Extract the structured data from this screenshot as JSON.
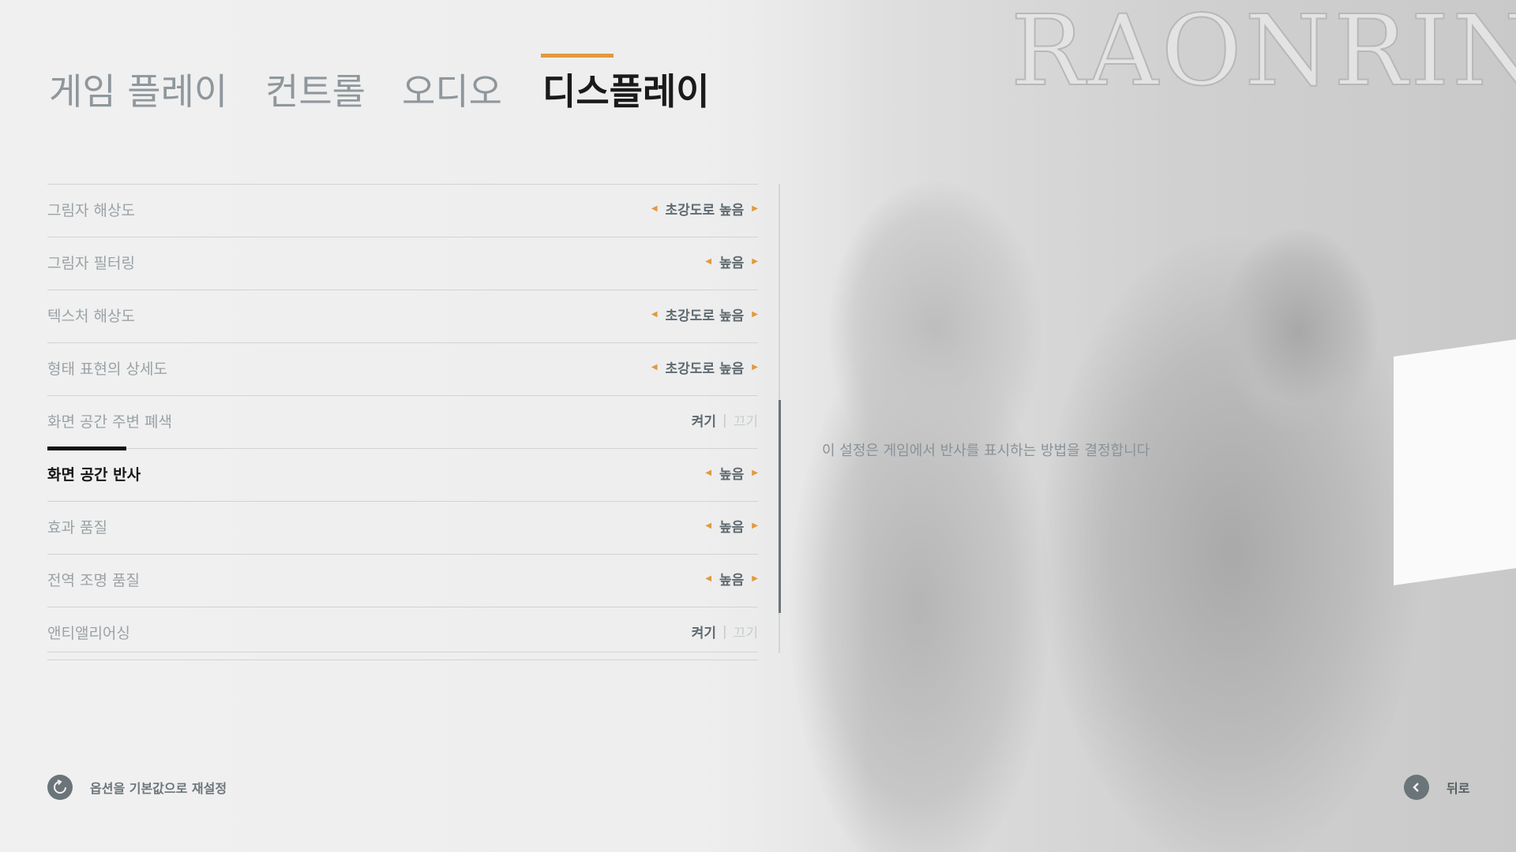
{
  "logo": {
    "text": "RAONRIN"
  },
  "tabs": [
    {
      "label": "게임 플레이",
      "active": false
    },
    {
      "label": "컨트롤",
      "active": false
    },
    {
      "label": "오디오",
      "active": false
    },
    {
      "label": "디스플레이",
      "active": true
    }
  ],
  "settings": [
    {
      "label": "그림자 해상도",
      "type": "selector",
      "value": "초강도로 높음"
    },
    {
      "label": "그림자 필터링",
      "type": "selector",
      "value": "높음"
    },
    {
      "label": "텍스처 해상도",
      "type": "selector",
      "value": "초강도로 높음"
    },
    {
      "label": "형태 표현의 상세도",
      "type": "selector",
      "value": "초강도로 높음"
    },
    {
      "label": "화면 공간 주변 폐색",
      "type": "toggle",
      "on_label": "켜기",
      "off_label": "끄기"
    },
    {
      "label": "화면 공간 반사",
      "type": "selector",
      "value": "높음",
      "selected": true
    },
    {
      "label": "효과 품질",
      "type": "selector",
      "value": "높음"
    },
    {
      "label": "전역 조명 품질",
      "type": "selector",
      "value": "높음"
    },
    {
      "label": "앤티앨리어싱",
      "type": "toggle",
      "on_label": "켜기",
      "off_label": "끄기"
    }
  ],
  "description": "이 설정은 게임에서 반사를 표시하는 방법을 결정합니다",
  "footer": {
    "reset_label": "옵션을 기본값으로 재설정",
    "back_label": "뒤로"
  },
  "icons": {
    "reset": "reset-icon",
    "back": "back-arrow-icon",
    "arrow_left": "arrow-left-icon",
    "arrow_right": "arrow-right-icon"
  },
  "colors": {
    "accent": "#e2983f",
    "active_text": "#151515",
    "inactive_text": "#9aa2a6"
  }
}
